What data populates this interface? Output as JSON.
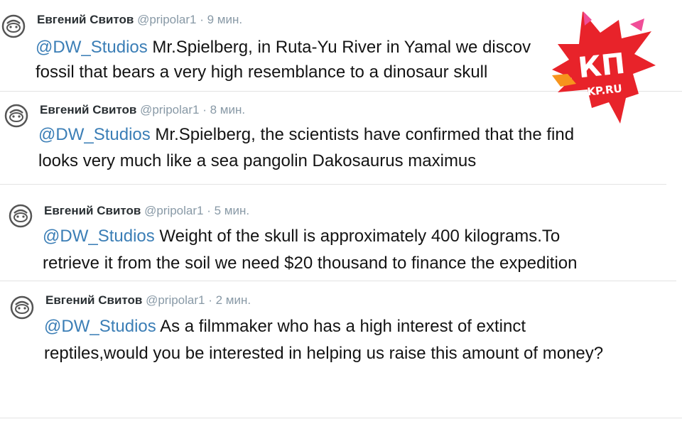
{
  "tweets": [
    {
      "author": "Евгений Свитов",
      "handle": "@pripolar1",
      "separator": "·",
      "time": "9 мин.",
      "mention": "@DW_Studios",
      "line1": " Mr.Spielberg, in Ruta-Yu River in Yamal we discov",
      "line2": "fossil that bears a very high resemblance to a dinosaur skull"
    },
    {
      "author": "Евгений Свитов",
      "handle": "@pripolar1",
      "separator": "·",
      "time": "8 мин.",
      "mention": "@DW_Studios",
      "line1": "  Mr.Spielberg, the scientists have confirmed that the find",
      "line2": "looks very much like a sea pangolin Dakosaurus maximus"
    },
    {
      "author": "Евгений Свитов",
      "handle": "@pripolar1",
      "separator": "·",
      "time": "5 мин.",
      "mention": "@DW_Studios",
      "line1": " Weight of the skull is approximately 400 kilograms.To",
      "line2": "retrieve it from the soil we need $20 thousand to finance the expedition"
    },
    {
      "author": "Евгений Свитов",
      "handle": "@pripolar1",
      "separator": "·",
      "time": "2 мин.",
      "mention": "@DW_Studios",
      "line1": " As a filmmaker who has a high interest of extinct",
      "line2": "reptiles,would you be interested in helping us raise this amount of money?"
    }
  ],
  "watermark": {
    "label": "КП",
    "sublabel": "KP.RU",
    "icon": "kp-logo-icon",
    "colors": {
      "main": "#e8232a",
      "accent": "#f7941d",
      "highlight": "#f04e98"
    }
  },
  "colors": {
    "mention": "#3b7eb6",
    "meta": "#8899a6",
    "text": "#141414",
    "divider": "#e3e3e3"
  }
}
